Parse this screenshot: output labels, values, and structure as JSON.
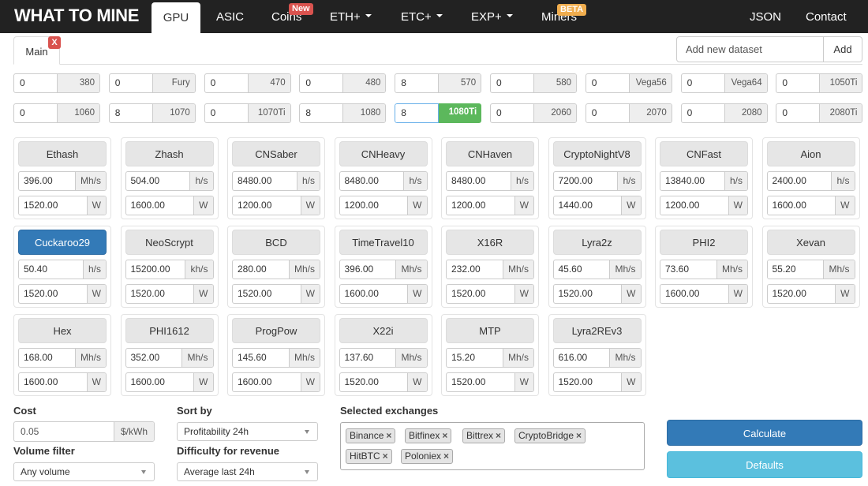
{
  "nav": {
    "brand": "WHAT TO MINE",
    "gpu": "GPU",
    "asic": "ASIC",
    "coins": "Coins",
    "coins_badge": "New",
    "eth": "ETH+",
    "etc": "ETC+",
    "exp": "EXP+",
    "miners": "Miners",
    "miners_badge": "BETA",
    "json": "JSON",
    "contact": "Contact"
  },
  "tabs": {
    "main": "Main",
    "close": "X",
    "dataset_placeholder": "Add new dataset",
    "add": "Add"
  },
  "gpus": [
    {
      "qty": "0",
      "name": "380"
    },
    {
      "qty": "0",
      "name": "Fury"
    },
    {
      "qty": "0",
      "name": "470"
    },
    {
      "qty": "0",
      "name": "480"
    },
    {
      "qty": "8",
      "name": "570"
    },
    {
      "qty": "0",
      "name": "580"
    },
    {
      "qty": "0",
      "name": "Vega56"
    },
    {
      "qty": "0",
      "name": "Vega64"
    },
    {
      "qty": "0",
      "name": "1050Ti"
    },
    {
      "qty": "0",
      "name": "1060"
    },
    {
      "qty": "8",
      "name": "1070"
    },
    {
      "qty": "0",
      "name": "1070Ti"
    },
    {
      "qty": "8",
      "name": "1080"
    },
    {
      "qty": "8",
      "name": "1080Ti"
    },
    {
      "qty": "0",
      "name": "2060"
    },
    {
      "qty": "0",
      "name": "2070"
    },
    {
      "qty": "0",
      "name": "2080"
    },
    {
      "qty": "0",
      "name": "2080Ti"
    }
  ],
  "algos": [
    {
      "name": "Ethash",
      "hashrate": "396.00",
      "hash_unit": "Mh/s",
      "power": "1520.00",
      "power_unit": "W"
    },
    {
      "name": "Zhash",
      "hashrate": "504.00",
      "hash_unit": "h/s",
      "power": "1600.00",
      "power_unit": "W"
    },
    {
      "name": "CNSaber",
      "hashrate": "8480.00",
      "hash_unit": "h/s",
      "power": "1200.00",
      "power_unit": "W"
    },
    {
      "name": "CNHeavy",
      "hashrate": "8480.00",
      "hash_unit": "h/s",
      "power": "1200.00",
      "power_unit": "W"
    },
    {
      "name": "CNHaven",
      "hashrate": "8480.00",
      "hash_unit": "h/s",
      "power": "1200.00",
      "power_unit": "W"
    },
    {
      "name": "CryptoNightV8",
      "hashrate": "7200.00",
      "hash_unit": "h/s",
      "power": "1440.00",
      "power_unit": "W"
    },
    {
      "name": "CNFast",
      "hashrate": "13840.00",
      "hash_unit": "h/s",
      "power": "1200.00",
      "power_unit": "W"
    },
    {
      "name": "Aion",
      "hashrate": "2400.00",
      "hash_unit": "h/s",
      "power": "1600.00",
      "power_unit": "W"
    },
    {
      "name": "Cuckaroo29",
      "hashrate": "50.40",
      "hash_unit": "h/s",
      "power": "1520.00",
      "power_unit": "W"
    },
    {
      "name": "NeoScrypt",
      "hashrate": "15200.00",
      "hash_unit": "kh/s",
      "power": "1520.00",
      "power_unit": "W"
    },
    {
      "name": "BCD",
      "hashrate": "280.00",
      "hash_unit": "Mh/s",
      "power": "1520.00",
      "power_unit": "W"
    },
    {
      "name": "TimeTravel10",
      "hashrate": "396.00",
      "hash_unit": "Mh/s",
      "power": "1600.00",
      "power_unit": "W"
    },
    {
      "name": "X16R",
      "hashrate": "232.00",
      "hash_unit": "Mh/s",
      "power": "1520.00",
      "power_unit": "W"
    },
    {
      "name": "Lyra2z",
      "hashrate": "45.60",
      "hash_unit": "Mh/s",
      "power": "1520.00",
      "power_unit": "W"
    },
    {
      "name": "PHI2",
      "hashrate": "73.60",
      "hash_unit": "Mh/s",
      "power": "1600.00",
      "power_unit": "W"
    },
    {
      "name": "Xevan",
      "hashrate": "55.20",
      "hash_unit": "Mh/s",
      "power": "1520.00",
      "power_unit": "W"
    },
    {
      "name": "Hex",
      "hashrate": "168.00",
      "hash_unit": "Mh/s",
      "power": "1600.00",
      "power_unit": "W"
    },
    {
      "name": "PHI1612",
      "hashrate": "352.00",
      "hash_unit": "Mh/s",
      "power": "1600.00",
      "power_unit": "W"
    },
    {
      "name": "ProgPow",
      "hashrate": "145.60",
      "hash_unit": "Mh/s",
      "power": "1600.00",
      "power_unit": "W"
    },
    {
      "name": "X22i",
      "hashrate": "137.60",
      "hash_unit": "Mh/s",
      "power": "1520.00",
      "power_unit": "W"
    },
    {
      "name": "MTP",
      "hashrate": "15.20",
      "hash_unit": "Mh/s",
      "power": "1520.00",
      "power_unit": "W"
    },
    {
      "name": "Lyra2REv3",
      "hashrate": "616.00",
      "hash_unit": "Mh/s",
      "power": "1520.00",
      "power_unit": "W"
    }
  ],
  "bottom": {
    "cost_label": "Cost",
    "cost_value": "0.05",
    "cost_unit": "$/kWh",
    "volume_label": "Volume filter",
    "volume_value": "Any volume",
    "sort_label": "Sort by",
    "sort_value": "Profitability 24h",
    "difficulty_label": "Difficulty for revenue",
    "difficulty_value": "Average last 24h",
    "exchanges_label": "Selected exchanges",
    "exchanges": [
      "Binance",
      "Bitfinex",
      "Bittrex",
      "CryptoBridge",
      "HitBTC",
      "Poloniex"
    ],
    "remove_symbol": "×",
    "calculate": "Calculate",
    "defaults": "Defaults"
  },
  "colors": {
    "navbar": "#222222",
    "primary": "#337ab7",
    "info": "#5bc0de",
    "success": "#5cb85c",
    "danger": "#d9534f",
    "warning": "#f0ad4e"
  }
}
